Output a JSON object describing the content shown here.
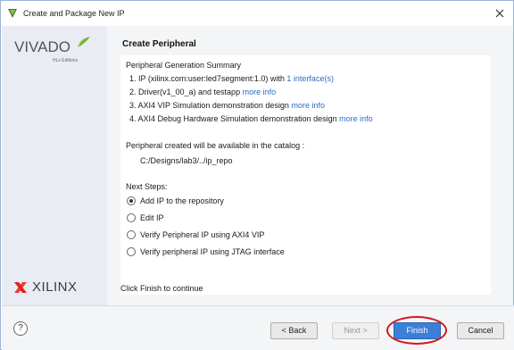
{
  "window": {
    "title": "Create and Package New IP",
    "close_icon": "close-icon"
  },
  "sidebar": {
    "logo_text": "VIVADO",
    "logo_subtext": "HLx Editions",
    "vendor_text": "XILINX",
    "vendor_icon": "xilinx-logo-icon"
  },
  "page": {
    "heading": "Create Peripheral",
    "summary_title": "Peripheral Generation Summary",
    "items": [
      {
        "text": "1. IP (xilinx.com:user:led7segment:1.0) with ",
        "link": "1 interface(s)"
      },
      {
        "text": "2. Driver(v1_00_a) and testapp ",
        "link": "more info"
      },
      {
        "text": "3. AXI4 VIP Simulation demonstration design ",
        "link": "more info"
      },
      {
        "text": "4. AXI4 Debug Hardware Simulation demonstration design ",
        "link": "more info"
      }
    ],
    "catalog_text": "Peripheral created will be available in the catalog :",
    "repo_path": "C:/Designs/lab3/../ip_repo",
    "next_steps_label": "Next Steps:",
    "options": [
      {
        "label": "Add IP to the repository",
        "checked": true
      },
      {
        "label": "Edit IP",
        "checked": false
      },
      {
        "label": "Verify Peripheral IP using AXI4 VIP",
        "checked": false
      },
      {
        "label": "Verify peripheral IP using JTAG interface",
        "checked": false
      }
    ],
    "finish_note": "Click Finish to continue"
  },
  "buttons": {
    "help": "?",
    "back": "< Back",
    "next": "Next >",
    "finish": "Finish",
    "cancel": "Cancel"
  },
  "colors": {
    "accent": "#3c7fd6",
    "link": "#2c6cc9",
    "highlight_ring": "#d11a1a",
    "sidebar_bg": "#e9edf3"
  }
}
